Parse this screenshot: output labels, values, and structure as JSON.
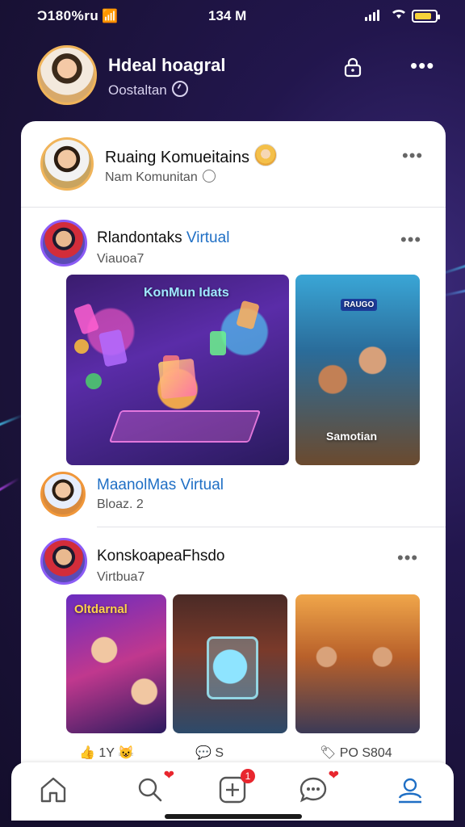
{
  "status_bar": {
    "carrier": "Ɔ180%ru",
    "time": "134 M"
  },
  "header": {
    "title": "Hdeal hoagral",
    "subtitle": "Oostaltan"
  },
  "community": {
    "name": "Ruaing Komueitains",
    "subtitle": "Nam Komunitan"
  },
  "posts": [
    {
      "name_part1": "Rlandontaks",
      "name_part2": " Virtual",
      "sub": "Viauoa7",
      "image1_label": "KonMun Idats",
      "image2_label_top": "RAUGO",
      "image2_label_bottom": "Samotian"
    },
    {
      "name": "MaanolMas Virtual",
      "sub": "Bloaz. 2"
    },
    {
      "name": "KonskoapeaFhsdo",
      "sub": "Virtbua7",
      "image1_label": "Oltdarnal"
    }
  ],
  "reactions": {
    "likes": "1Y",
    "comments": "S",
    "shares": "PO S804"
  },
  "tabbar": {
    "add_badge": "1"
  },
  "colors": {
    "accent": "#1f6fc5",
    "badge": "#e8262e",
    "background": "#1a1238"
  }
}
